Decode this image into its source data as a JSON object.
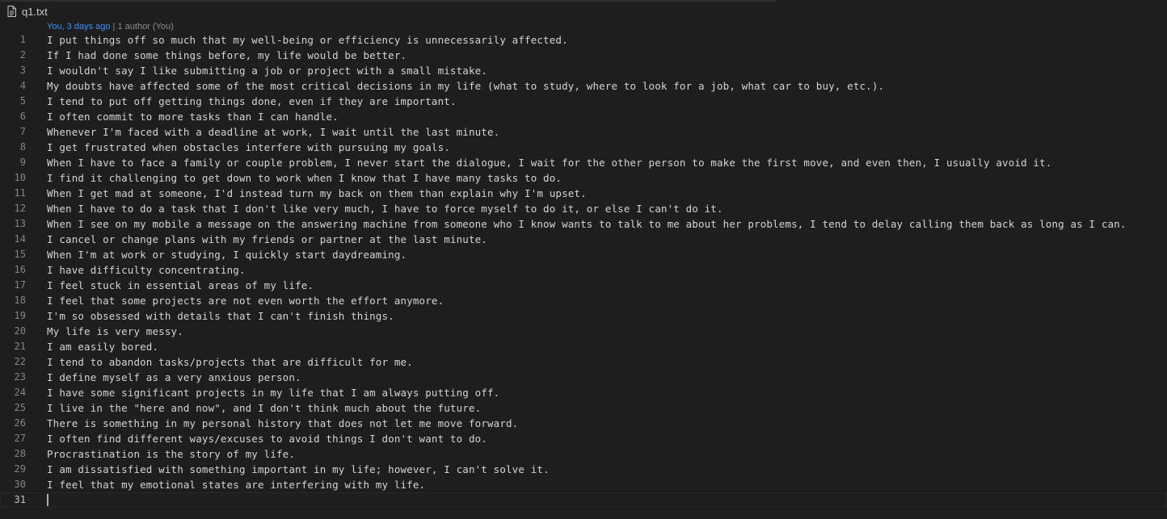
{
  "file": {
    "name": "q1.txt",
    "icon": "file-text-icon"
  },
  "blame": {
    "author": "You, 3 days ago",
    "separator": " | ",
    "summary": "1 author (You)"
  },
  "lines": [
    {
      "number": "1",
      "text": "I put things off so much that my well-being or efficiency is unnecessarily affected."
    },
    {
      "number": "2",
      "text": "If I had done some things before, my life would be better."
    },
    {
      "number": "3",
      "text": "I wouldn't say I like submitting a job or project with a small mistake."
    },
    {
      "number": "4",
      "text": "My doubts have affected some of the most critical decisions in my life (what to study, where to look for a job, what car to buy, etc.)."
    },
    {
      "number": "5",
      "text": "I tend to put off getting things done, even if they are important."
    },
    {
      "number": "6",
      "text": "I often commit to more tasks than I can handle."
    },
    {
      "number": "7",
      "text": "Whenever I'm faced with a deadline at work, I wait until the last minute."
    },
    {
      "number": "8",
      "text": "I get frustrated when obstacles interfere with pursuing my goals."
    },
    {
      "number": "9",
      "text": "When I have to face a family or couple problem, I never start the dialogue, I wait for the other person to make the first move, and even then, I usually avoid it."
    },
    {
      "number": "10",
      "text": "I find it challenging to get down to work when I know that I have many tasks to do."
    },
    {
      "number": "11",
      "text": "When I get mad at someone, I'd instead turn my back on them than explain why I'm upset."
    },
    {
      "number": "12",
      "text": "When I have to do a task that I don't like very much, I have to force myself to do it, or else I can't do it."
    },
    {
      "number": "13",
      "text": "When I see on my mobile a message on the answering machine from someone who I know wants to talk to me about her problems, I tend to delay calling them back as long as I can."
    },
    {
      "number": "14",
      "text": "I cancel or change plans with my friends or partner at the last minute."
    },
    {
      "number": "15",
      "text": "When I'm at work or studying, I quickly start daydreaming."
    },
    {
      "number": "16",
      "text": "I have difficulty concentrating."
    },
    {
      "number": "17",
      "text": "I feel stuck in essential areas of my life."
    },
    {
      "number": "18",
      "text": "I feel that some projects are not even worth the effort anymore."
    },
    {
      "number": "19",
      "text": "I'm so obsessed with details that I can't finish things."
    },
    {
      "number": "20",
      "text": "My life is very messy."
    },
    {
      "number": "21",
      "text": "I am easily bored."
    },
    {
      "number": "22",
      "text": "I tend to abandon tasks/projects that are difficult for me."
    },
    {
      "number": "23",
      "text": "I define myself as a very anxious person."
    },
    {
      "number": "24",
      "text": "I have some significant projects in my life that I am always putting off."
    },
    {
      "number": "25",
      "text": "I live in the \"here and now\", and I don't think much about the future."
    },
    {
      "number": "26",
      "text": "There is something in my personal history that does not let me move forward."
    },
    {
      "number": "27",
      "text": "I often find different ways/excuses to avoid things I don't want to do."
    },
    {
      "number": "28",
      "text": "Procrastination is the story of my life."
    },
    {
      "number": "29",
      "text": "I am dissatisfied with something important in my life; however, I can't solve it."
    },
    {
      "number": "30",
      "text": "I feel that my emotional states are interfering with my life."
    },
    {
      "number": "31",
      "text": ""
    }
  ],
  "current_line": "31"
}
